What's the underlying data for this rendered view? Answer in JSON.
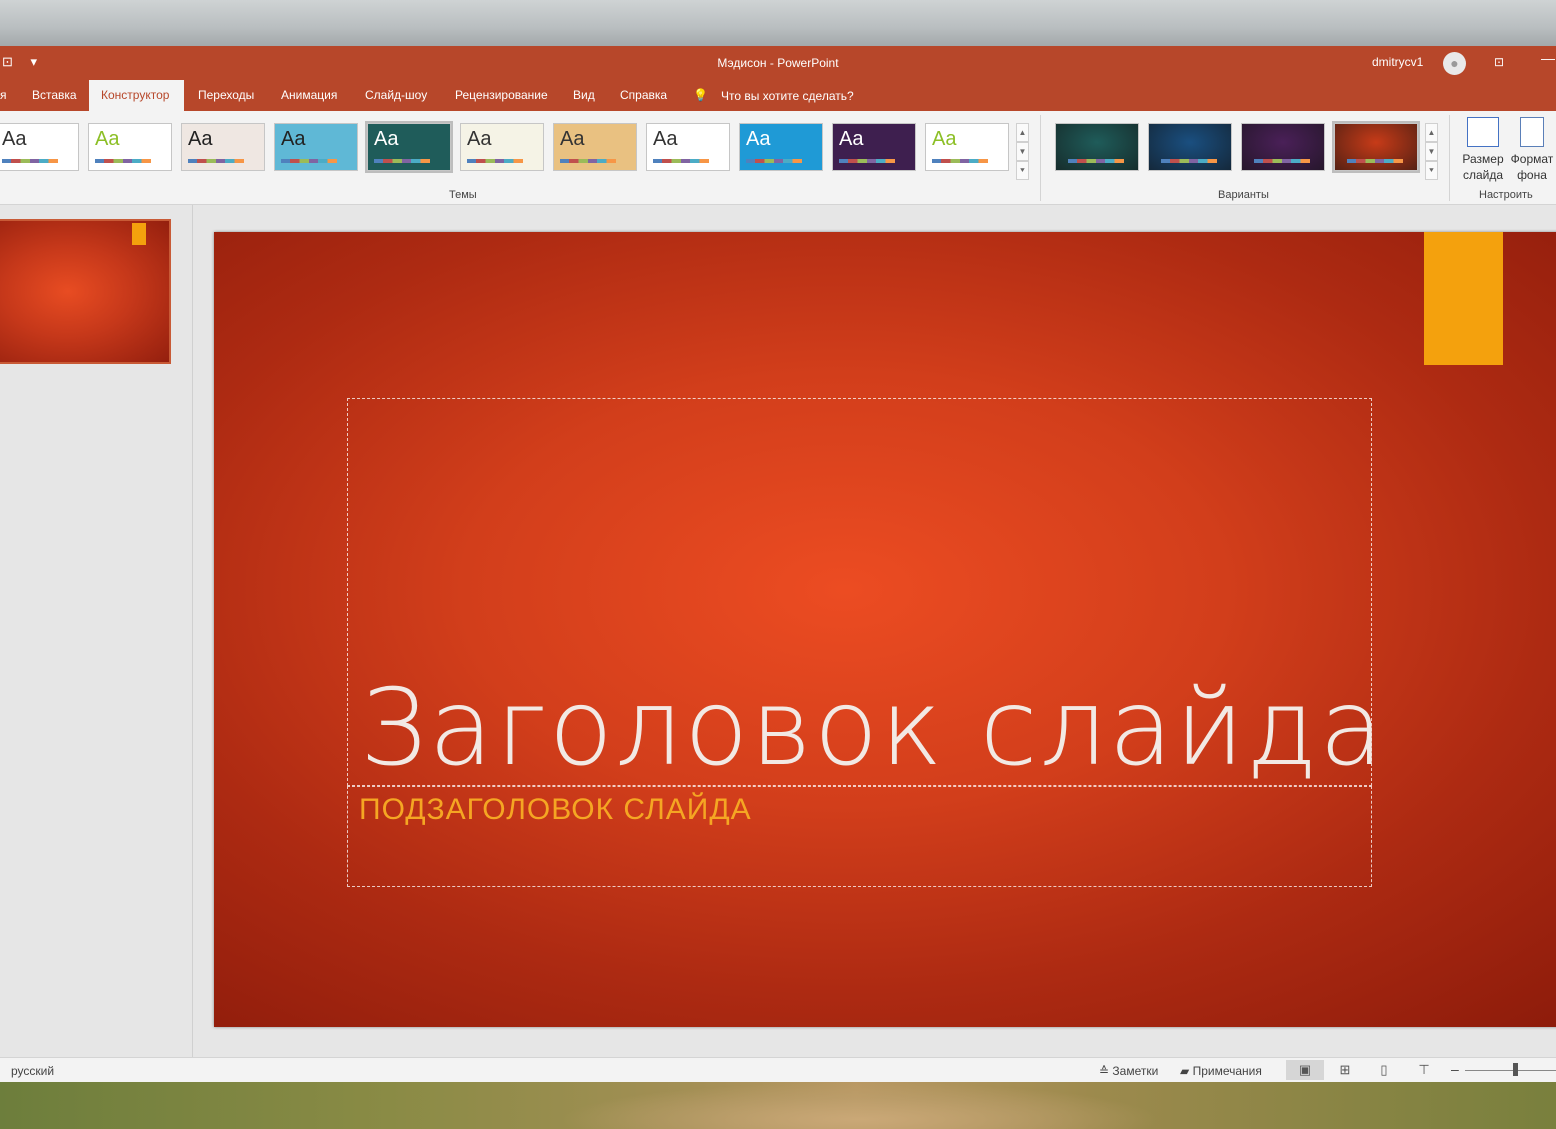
{
  "window": {
    "title": "Мэдисон  -  PowerPoint",
    "user": "dmitrycv1",
    "qat_icons": [
      "slideshow-from-start-icon",
      "customize-qat-icon"
    ]
  },
  "tabs": [
    {
      "label": "я",
      "active": false
    },
    {
      "label": "Вставка",
      "active": false
    },
    {
      "label": "Конструктор",
      "active": true
    },
    {
      "label": "Переходы",
      "active": false
    },
    {
      "label": "Анимация",
      "active": false
    },
    {
      "label": "Слайд-шоу",
      "active": false
    },
    {
      "label": "Рецензирование",
      "active": false
    },
    {
      "label": "Вид",
      "active": false
    },
    {
      "label": "Справка",
      "active": false
    }
  ],
  "tell_me": "Что вы хотите сделать?",
  "ribbon": {
    "themes_label": "Темы",
    "variants_label": "Варианты",
    "customize_label": "Настроить",
    "slide_size": "Размер слайда",
    "slide_size_line1": "Размер",
    "slide_size_line2": "слайда",
    "format_bg_line1": "Формат",
    "format_bg_line2": "фона",
    "theme_sample": "Aa",
    "themes": [
      {
        "name": "office-theme",
        "bg": "#ffffff",
        "fg": "#333333"
      },
      {
        "name": "facet-green-theme",
        "bg": "#ffffff",
        "fg": "#8cbf26"
      },
      {
        "name": "brown-theme",
        "bg": "#efe7e2",
        "fg": "#222222"
      },
      {
        "name": "pattern-blue-theme",
        "bg": "#5fb8d6",
        "fg": "#222222"
      },
      {
        "name": "teal-dark-theme",
        "bg": "#1f5c5a",
        "fg": "#ffffff"
      },
      {
        "name": "cream-theme",
        "bg": "#f5f3e6",
        "fg": "#333333"
      },
      {
        "name": "parchment-theme",
        "bg": "#e9c181",
        "fg": "#333333"
      },
      {
        "name": "white-theme",
        "bg": "#ffffff",
        "fg": "#333333"
      },
      {
        "name": "blue-gradient-theme",
        "bg": "#1f9ad6",
        "fg": "#ffffff"
      },
      {
        "name": "purple-theme",
        "bg": "#3e1f4f",
        "fg": "#ffffff"
      },
      {
        "name": "green-facet-theme",
        "bg": "#ffffff",
        "fg": "#8cbf26"
      }
    ],
    "variants": [
      {
        "name": "variant-teal",
        "bg": "#1f5c5a"
      },
      {
        "name": "variant-blue",
        "bg": "#1a4f80"
      },
      {
        "name": "variant-purple",
        "bg": "#4a2058"
      },
      {
        "name": "variant-red",
        "bg": "#c73b18"
      }
    ]
  },
  "slide": {
    "title": "Заголовок слайда",
    "subtitle": "ПОДЗАГОЛОВОК СЛАЙДА",
    "accent_color": "#f4a10d",
    "background_color": "#d23e1b"
  },
  "status": {
    "language": "русский",
    "notes": "Заметки",
    "comments": "Примечания"
  }
}
